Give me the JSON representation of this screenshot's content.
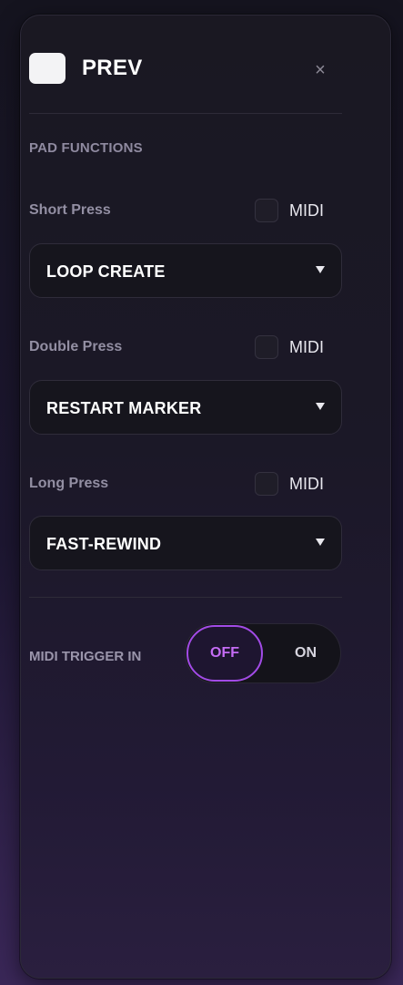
{
  "header": {
    "title": "PREV",
    "close_icon": "close-icon",
    "close_glyph": "×",
    "swatch_color": "#f3f3f5"
  },
  "section": {
    "title": "PAD FUNCTIONS"
  },
  "functions": [
    {
      "label": "Short Press",
      "midi_label": "MIDI",
      "midi_checked": false,
      "value": "LOOP CREATE"
    },
    {
      "label": "Double Press",
      "midi_label": "MIDI",
      "midi_checked": false,
      "value": "RESTART MARKER"
    },
    {
      "label": "Long Press",
      "midi_label": "MIDI",
      "midi_checked": false,
      "value": "FAST-REWIND"
    }
  ],
  "trigger": {
    "label": "MIDI TRIGGER IN",
    "off_label": "OFF",
    "on_label": "ON",
    "selected": "OFF"
  },
  "colors": {
    "accent": "#a24be6",
    "accent_text": "#c56cf5"
  }
}
